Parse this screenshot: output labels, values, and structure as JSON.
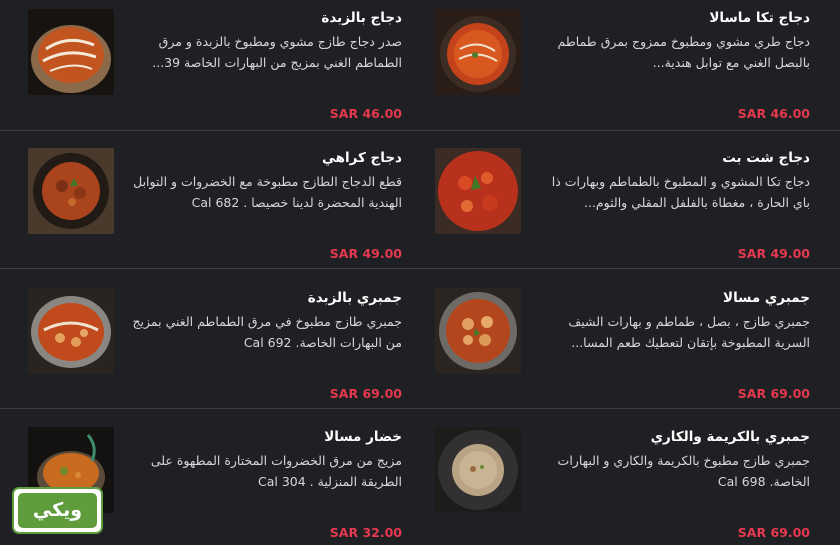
{
  "menu": {
    "items": [
      {
        "name": "دجاج تكا ماسالا",
        "desc": "دجاج طري مشوي ومطبوخ ممزوج بمرق طماطم بالبصل الغني مع توابل هندية...",
        "price": "SAR 46.00",
        "image": "orange-curry-bowl"
      },
      {
        "name": "دجاج بالزبدة",
        "desc": "صدر دجاج طازج مشوي ومطبوخ بالزبدة و مرق الطماطم الغني بمزيج من البهارات الخاصة 39...",
        "price": "SAR 46.00",
        "image": "butter-chicken-pot"
      },
      {
        "name": "دجاج شت بت",
        "desc": "دجاج تكا المشوي و المطبوخ بالطماطم وبهارات ذا باي الحارة ، مغطاة بالفلفل المقلي والثوم...",
        "price": "SAR 49.00",
        "image": "red-chili-chicken"
      },
      {
        "name": "دجاج كراهي",
        "desc": "قطع الدجاج الطازج مطبوخة مع الخضروات و التوابل الهندية المحضرة لدينا خصيصا . Cal 682",
        "price": "SAR 49.00",
        "image": "karahi-bowl"
      },
      {
        "name": "جمبري مسالا",
        "desc": "جمبري طازج ، بصل ، طماطم و بهارات الشيف السرية المطبوخة بإتقان لتعطيك طعم المسا...",
        "price": "SAR 69.00",
        "image": "shrimp-masala-bowl"
      },
      {
        "name": "جمبري بالزبدة",
        "desc": "جمبري طازج مطبوخ في مرق الطماطم الغني بمزيج من البهارات الخاصة. Cal 692",
        "price": "SAR 69.00",
        "image": "butter-shrimp-bowl"
      },
      {
        "name": "جمبري بالكريمة والكاري",
        "desc": "جمبري طازج مطبوخ بالكريمة والكاري و البهارات الخاصة. Cal 698",
        "price": "SAR 69.00",
        "image": "creamy-curry-bowl"
      },
      {
        "name": "خضار مسالا",
        "desc": "مزيج من مرق الخضروات المختارة المطهوة على الطريقة المنزلية . Cal 304",
        "price": "SAR 32.00",
        "image": "veg-masala-bowl"
      }
    ]
  },
  "badge": {
    "label": "ويكي"
  },
  "colors": {
    "background": "#1f2024",
    "price": "#e6394f",
    "badge": "#5f9c3b"
  }
}
